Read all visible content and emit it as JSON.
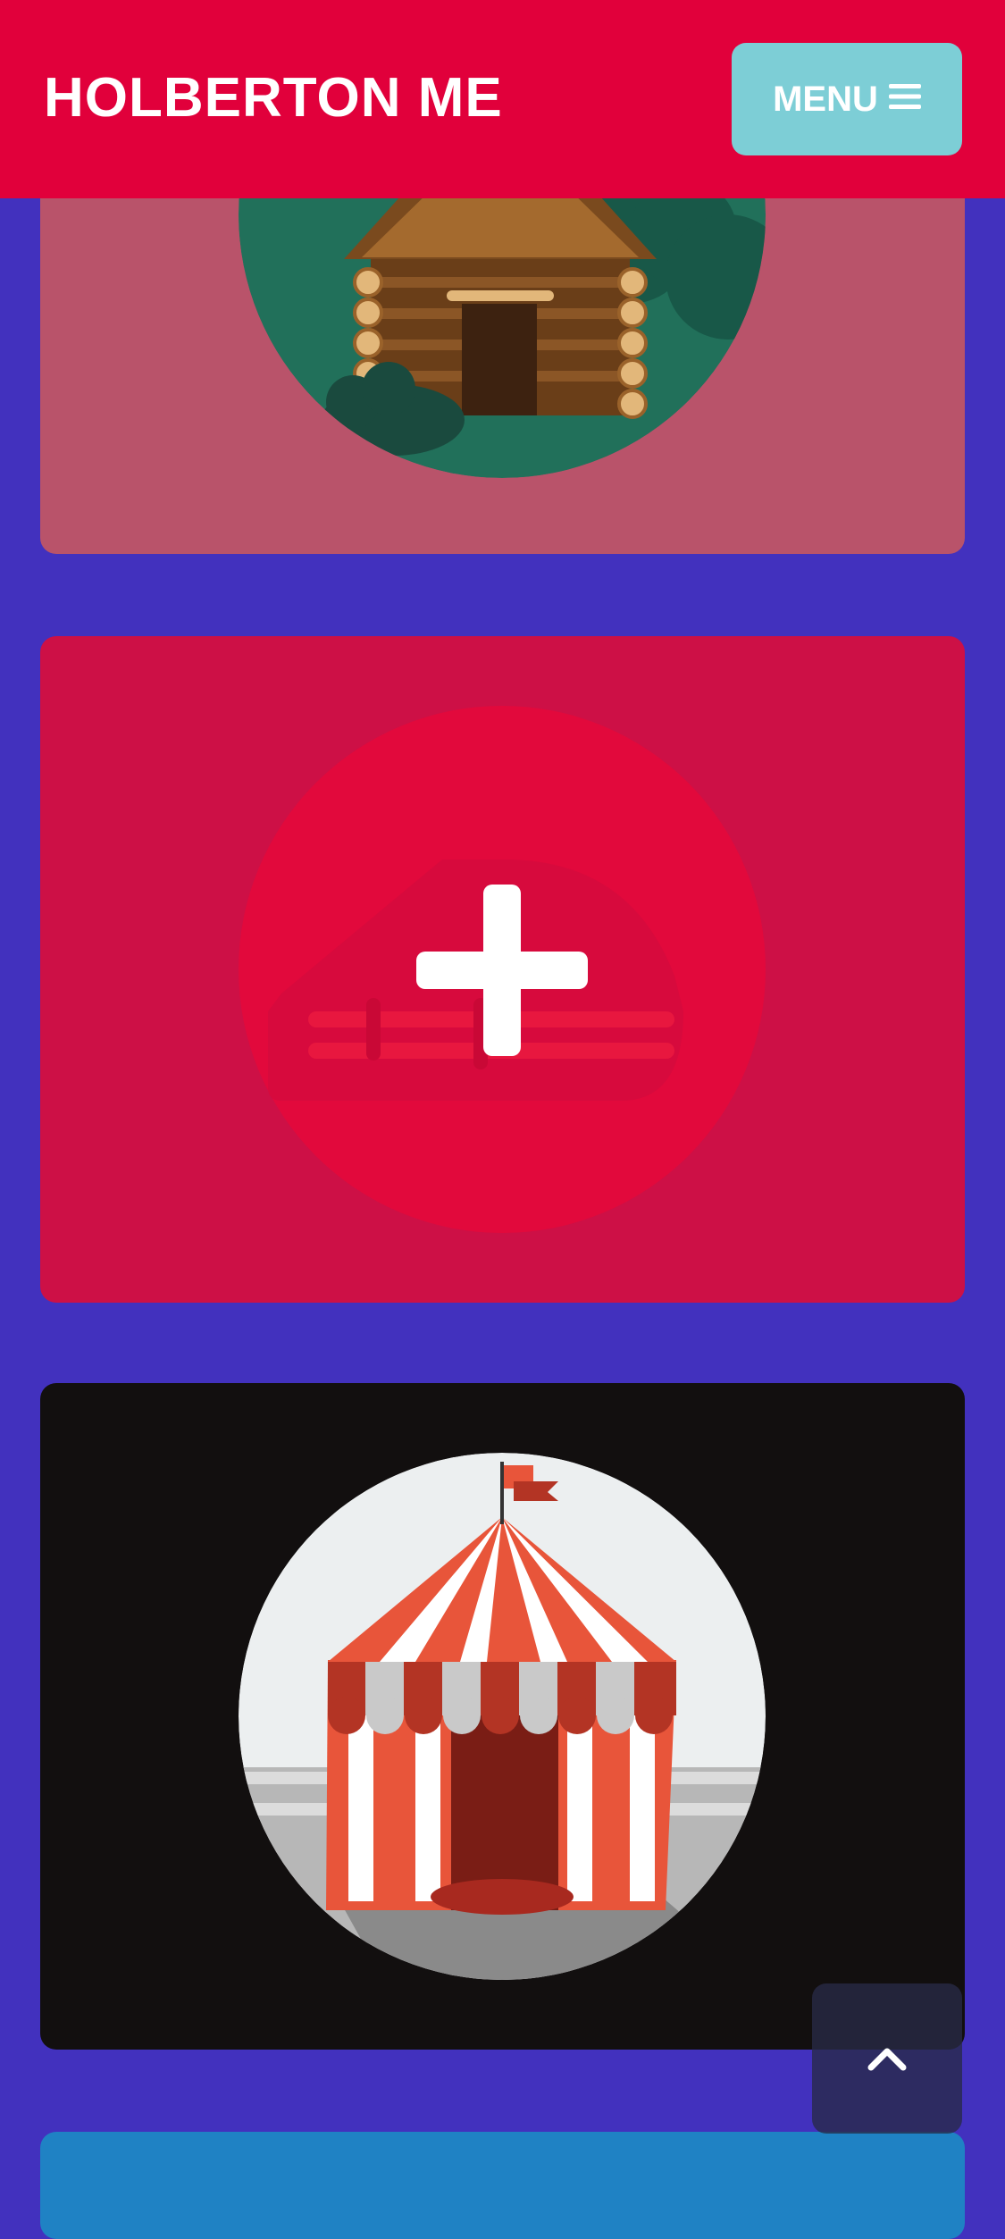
{
  "header": {
    "brand": "HOLBERTON ME",
    "menu_label": "MENU",
    "menu_icon": "hamburger-icon",
    "background": "#e1003b",
    "menu_background": "#7dced6"
  },
  "page": {
    "background": "#4231be"
  },
  "cards": [
    {
      "illustration": "log-cabin",
      "background": "#b9536a"
    },
    {
      "illustration": "add-plus-overlay",
      "background": "#cd1046"
    },
    {
      "illustration": "circus-tent",
      "background": "#120f0f"
    },
    {
      "background": "#1f82c4"
    }
  ],
  "back_to_top": {
    "icon": "chevron-up-icon"
  }
}
